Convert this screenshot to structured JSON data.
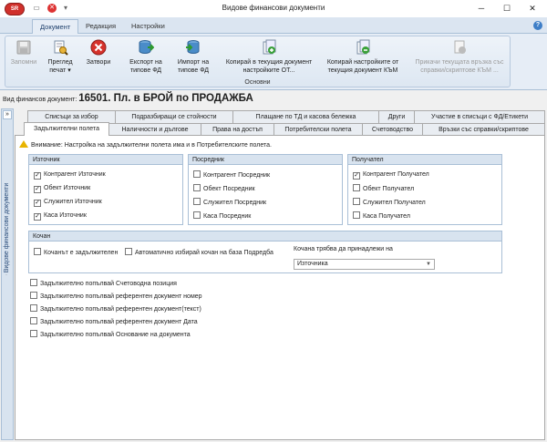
{
  "window": {
    "title": "Видове финансови документи",
    "app_logo": "SR",
    "minimize_icon": "─",
    "maximize_icon": "☐",
    "close_icon": "✕"
  },
  "quick_access": {
    "save_icon": "▭",
    "stop_icon": "✕",
    "dropdown_icon": "▾"
  },
  "menu": {
    "tabs": [
      {
        "label": "Документ",
        "active": true
      },
      {
        "label": "Редакция",
        "active": false
      },
      {
        "label": "Настройки",
        "active": false
      }
    ],
    "help_icon": "?"
  },
  "ribbon": {
    "buttons": [
      {
        "label": "Запомни",
        "icon": "save-icon",
        "enabled": false
      },
      {
        "label": "Преглед печат ▾",
        "icon": "print-preview-icon",
        "enabled": true
      },
      {
        "label": "Затвори",
        "icon": "close-icon",
        "enabled": true
      },
      {
        "label": "Експорт на типове ФД",
        "icon": "export-database-icon",
        "enabled": true
      },
      {
        "label": "Импорт на типове ФД",
        "icon": "import-database-icon",
        "enabled": true
      },
      {
        "label": "Копирай в текущия документ настройките ОТ...",
        "icon": "copy-from-icon",
        "enabled": true
      },
      {
        "label": "Копирай настройките от текущия документ КЪМ",
        "icon": "copy-to-icon",
        "enabled": true
      },
      {
        "label": "Прикачи текущата връзка със справки/скриптове КЪМ ...",
        "icon": "attach-link-icon",
        "enabled": false
      }
    ],
    "group_caption": "Основни"
  },
  "document": {
    "caption": "Вид финансов документ:",
    "value": "16501. Пл. в БРОЙ по ПРОДАЖБА"
  },
  "side_panel": {
    "label": "Видове финансови документи",
    "toggle_icon": "»"
  },
  "tabs_row1": [
    {
      "label": "Списъци за избор"
    },
    {
      "label": "Подразбиращи се стойности"
    },
    {
      "label": "Плащане по ТД и касова бележка"
    },
    {
      "label": "Други"
    },
    {
      "label": "Участие в списъци с ФД/Етикети"
    }
  ],
  "tabs_row2": [
    {
      "label": "Задължителни полета",
      "active": true
    },
    {
      "label": "Наличности и дългове",
      "active": false
    },
    {
      "label": "Права на достъп",
      "active": false
    },
    {
      "label": "Потребителски полета",
      "active": false
    },
    {
      "label": "Счетоводство",
      "active": false
    },
    {
      "label": "Връзки със справки/скриптове",
      "active": false
    }
  ],
  "warning": "Внимание: Настройка на задължителни полета има и в Потребителските полета.",
  "groups": {
    "source": {
      "title": "Източник",
      "items": [
        {
          "label": "Контрагент Източник",
          "checked": true
        },
        {
          "label": "Обект Източник",
          "checked": true
        },
        {
          "label": "Служител Източник",
          "checked": true
        },
        {
          "label": "Каса Източник",
          "checked": true
        }
      ]
    },
    "intermediary": {
      "title": "Посредник",
      "items": [
        {
          "label": "Контрагент Посредник",
          "checked": false
        },
        {
          "label": "Обект Посредник",
          "checked": false
        },
        {
          "label": "Служител Посредник",
          "checked": false
        },
        {
          "label": "Каса Посредник",
          "checked": false
        }
      ]
    },
    "recipient": {
      "title": "Получател",
      "items": [
        {
          "label": "Контрагент Получател",
          "checked": true
        },
        {
          "label": "Обект Получател",
          "checked": false
        },
        {
          "label": "Служител Получател",
          "checked": false
        },
        {
          "label": "Каса Получател",
          "checked": false
        }
      ]
    },
    "bucket": {
      "title": "Кочан",
      "required": {
        "label": "Кочанът е задължителен",
        "checked": false
      },
      "auto": {
        "label": "Автоматично избирай кочан на база Подредба",
        "checked": false
      },
      "belongs_label": "Кочана трябва да принадлежи на",
      "belongs_value": "Източника"
    }
  },
  "extra_checks": [
    {
      "label": "Задължително попълвай Счетоводна позиция",
      "checked": false
    },
    {
      "label": "Задължително попълвай референтен документ номер",
      "checked": false
    },
    {
      "label": "Задължително попълвай референтен документ(текст)",
      "checked": false
    },
    {
      "label": "Задължително попълвай референтен документ Дата",
      "checked": false
    },
    {
      "label": "Задължително попълвай Основание на документа",
      "checked": false
    }
  ]
}
